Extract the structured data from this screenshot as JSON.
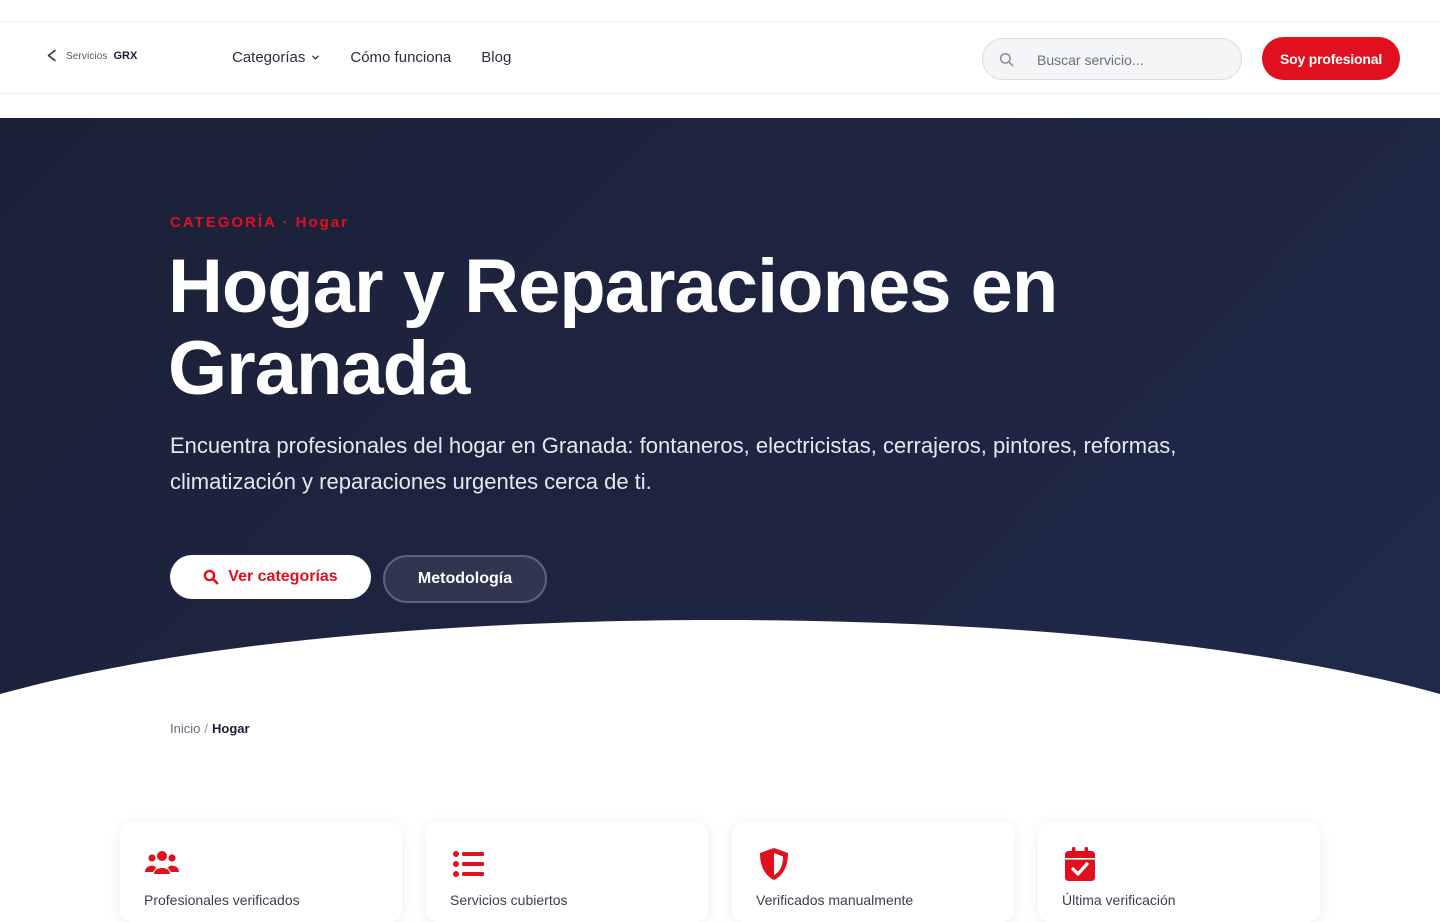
{
  "brand": {
    "prefix": "Servicios",
    "name": "GRX"
  },
  "nav": {
    "items": [
      {
        "label": "Categorías",
        "has_dropdown": true
      },
      {
        "label": "Cómo funciona",
        "has_dropdown": false
      },
      {
        "label": "Blog",
        "has_dropdown": false
      }
    ]
  },
  "search": {
    "placeholder": "Buscar servicio...",
    "value": ""
  },
  "header_cta": {
    "label": "Soy profesional"
  },
  "hero": {
    "overline": "CATEGORÍA · Hogar",
    "title": "Hogar y Reparaciones en Granada",
    "lead": "Encuentra profesionales del hogar en Granada: fontaneros, electricistas, cerrajeros, pintores, reformas, climatización y reparaciones urgentes cerca de ti.",
    "primary_button": {
      "label": "Ver categorías",
      "icon": "search-icon"
    },
    "secondary_button": {
      "label": "Metodología"
    }
  },
  "breadcrumb": {
    "home": "Inicio",
    "separator": "/",
    "current": "Hogar"
  },
  "stats": [
    {
      "icon": "users-icon",
      "label": "Profesionales verificados"
    },
    {
      "icon": "list-icon",
      "label": "Servicios cubiertos"
    },
    {
      "icon": "shield-icon",
      "label": "Verificados manualmente"
    },
    {
      "icon": "calendar-check-icon",
      "label": "Última verificación"
    }
  ],
  "colors": {
    "accent": "#e0101e",
    "hero_bg": "#1e2440",
    "text_dark": "#1a1f36"
  }
}
